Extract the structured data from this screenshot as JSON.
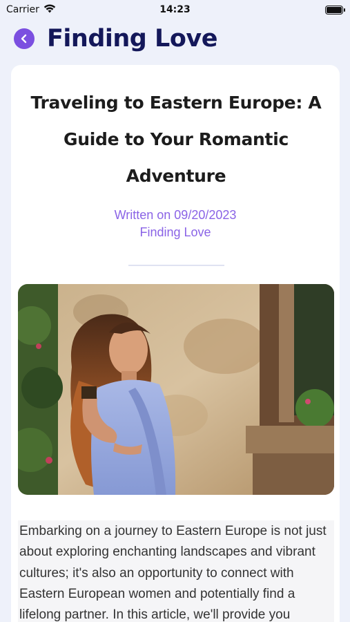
{
  "status": {
    "carrier": "Carrier",
    "time": "14:23"
  },
  "nav": {
    "title": "Finding Love"
  },
  "article": {
    "title": "Traveling to Eastern Europe: A Guide to Your Romantic Adventure",
    "date_line": "Written on 09/20/2023",
    "author": "Finding Love",
    "image_subject": "woman in lavender saree beside weathered stone wall",
    "body": "Embarking on a journey to Eastern Europe is not just about exploring enchanting landscapes and vibrant cultures; it's also an opportunity to connect with Eastern European women and potentially find a lifelong partner. In this article, we'll provide you"
  },
  "colors": {
    "accent": "#7b4fe0",
    "title_navy": "#14185a",
    "meta_purple": "#8a63e6",
    "background": "#eef1fa"
  },
  "icons": {
    "back": "chevron-left-icon",
    "wifi": "wifi-icon",
    "battery": "battery-icon"
  }
}
